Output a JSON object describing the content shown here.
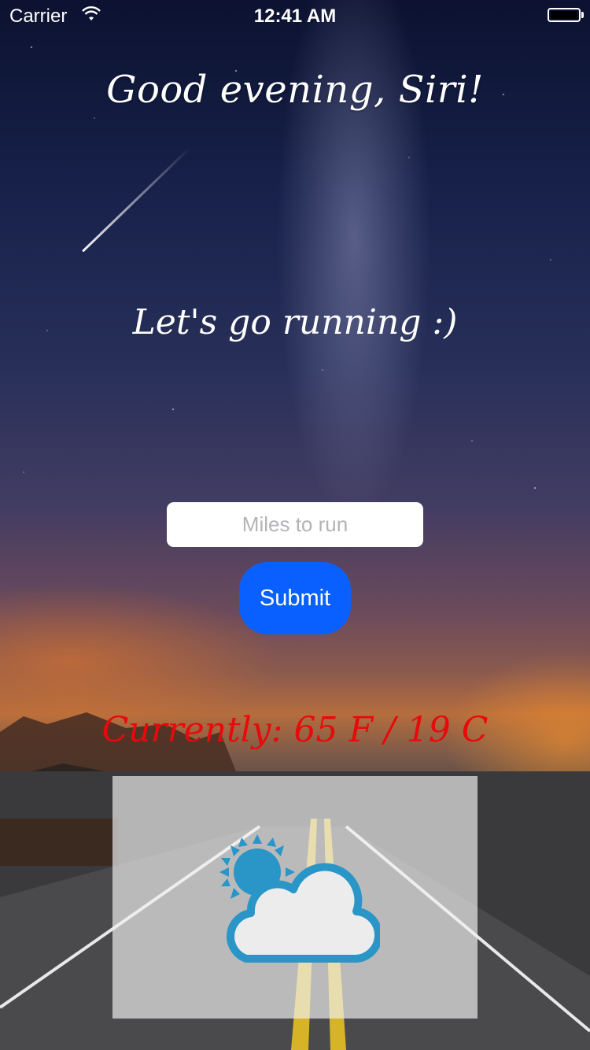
{
  "status_bar": {
    "carrier": "Carrier",
    "time": "12:41 AM",
    "wifi_icon": "wifi-icon",
    "battery_icon": "battery-icon"
  },
  "greeting": "Good evening, Siri!",
  "tagline": "Let's go running :)",
  "miles_input": {
    "value": "",
    "placeholder": "Miles to run"
  },
  "submit_label": "Submit",
  "weather": {
    "currently_text": "Currently: 65 F / 19 C",
    "icon": "partly-cloudy-icon",
    "icon_color": "#2a95c7",
    "text_color": "#e80a0a"
  },
  "colors": {
    "accent": "#0a60ff"
  }
}
